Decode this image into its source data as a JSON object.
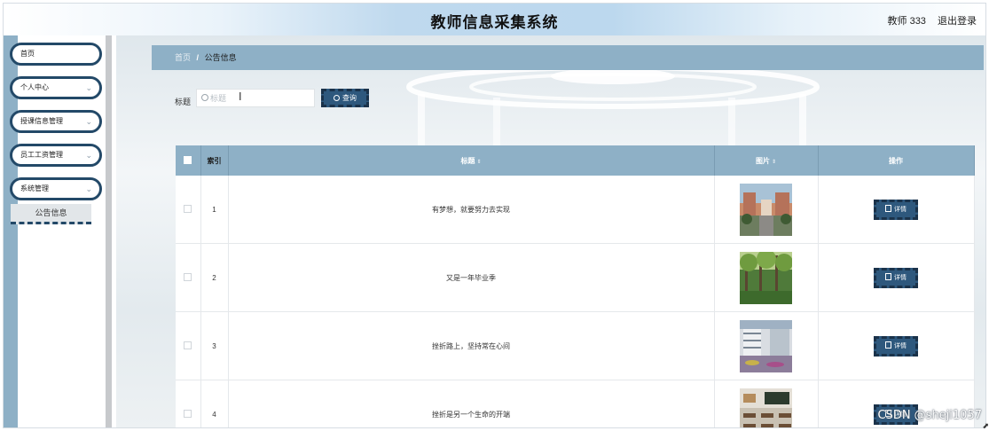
{
  "header": {
    "title": "教师信息采集系统",
    "user": "教师 333",
    "logout": "退出登录"
  },
  "sidebar": {
    "items": [
      {
        "label": "首页"
      },
      {
        "label": "个人中心"
      },
      {
        "label": "授课信息管理"
      },
      {
        "label": "员工工资管理"
      },
      {
        "label": "系统管理"
      }
    ],
    "submenu": {
      "label": "公告信息"
    }
  },
  "breadcrumb": {
    "home": "首页",
    "separator": "/",
    "current": "公告信息"
  },
  "search": {
    "label": "标题",
    "placeholder": "标题",
    "button": "查询"
  },
  "table": {
    "headers": {
      "index": "索引",
      "title": "标题",
      "image": "图片",
      "actions": "操作"
    },
    "detail_label": "详情",
    "rows": [
      {
        "index": "1",
        "title": "有梦想，就要努力去实现",
        "thumb": "campus-building-photo"
      },
      {
        "index": "2",
        "title": "又是一年毕业季",
        "thumb": "garden-trees-photo"
      },
      {
        "index": "3",
        "title": "挫折路上，坚持常在心间",
        "thumb": "library-atrium-photo"
      },
      {
        "index": "4",
        "title": "挫折是另一个生命的开端",
        "thumb": "classroom-photo"
      }
    ]
  },
  "watermark": "CSDN @sheji1057",
  "colors": {
    "accent": "#8eb0c6",
    "button": "#2e587d",
    "button_border": "#1a324a",
    "menu_border": "#234968"
  }
}
